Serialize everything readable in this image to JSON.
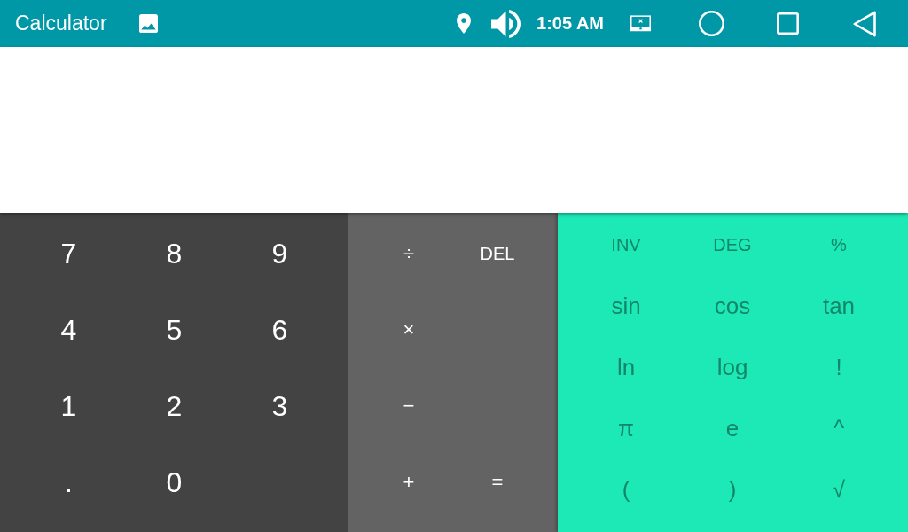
{
  "status_bar": {
    "title": "Calculator",
    "time": "1:05 AM"
  },
  "keypad": {
    "numbers": [
      [
        "7",
        "8",
        "9"
      ],
      [
        "4",
        "5",
        "6"
      ],
      [
        "1",
        "2",
        "3"
      ],
      [
        ".",
        "0"
      ]
    ],
    "operators": [
      [
        "÷",
        "DEL"
      ],
      [
        "×"
      ],
      [
        "−"
      ],
      [
        "+",
        "="
      ]
    ],
    "functions": [
      [
        "INV",
        "DEG",
        "%"
      ],
      [
        "sin",
        "cos",
        "tan"
      ],
      [
        "ln",
        "log",
        "!"
      ],
      [
        "π",
        "e",
        "^"
      ],
      [
        "(",
        ")",
        "√"
      ]
    ]
  }
}
